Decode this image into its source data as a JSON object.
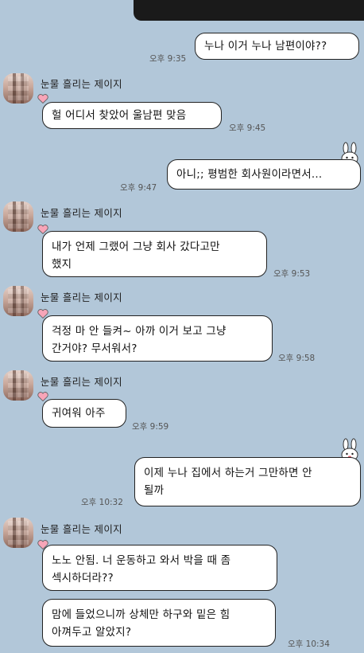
{
  "messages": {
    "m1": {
      "text": "누나 이거 누나 남편이야??",
      "time": "오후 9:35"
    },
    "m2": {
      "sender": "눈물 흘리는 제이지",
      "text": "헐 어디서 찾았어 울남편 맞음",
      "time": "오후 9:45"
    },
    "m3": {
      "text": "아니;; 평범한 회사원이라면서...",
      "time": "오후 9:47"
    },
    "m4": {
      "sender": "눈물 흘리는 제이지",
      "line1": "내가 언제 그랬어 그냥 회사 갔다고만",
      "line2": "했지",
      "time": "오후 9:53"
    },
    "m5": {
      "sender": "눈물 흘리는 제이지",
      "line1": "걱정 마 안 들켜~ 아까 이거 보고 그냥",
      "line2": "간거야? 무서워서?",
      "time": "오후 9:58"
    },
    "m6": {
      "sender": "눈물 흘리는 제이지",
      "text": "귀여워 아주",
      "time": "오후 9:59"
    },
    "m7": {
      "line1": "이제 누나 집에서 하는거 그만하면 안",
      "line2": "될까",
      "time": "오후 10:32"
    },
    "m8": {
      "sender": "눈물 흘리는 제이지",
      "line1": "노노 안됨. 너 운동하고 와서 박을 때 좀",
      "line2": "섹시하더라??"
    },
    "m9": {
      "line1": "맘에 들었으니까 상체만 하구와 밑은 힘",
      "line2": "아껴두고 알았지?",
      "time": "오후 10:34"
    }
  },
  "icons": {
    "heart": "heart-icon",
    "bunny": "bunny-sticker-icon"
  },
  "colors": {
    "background": "#b2c7d9",
    "bubble": "#ffffff",
    "heart": "#f7a5b8"
  }
}
